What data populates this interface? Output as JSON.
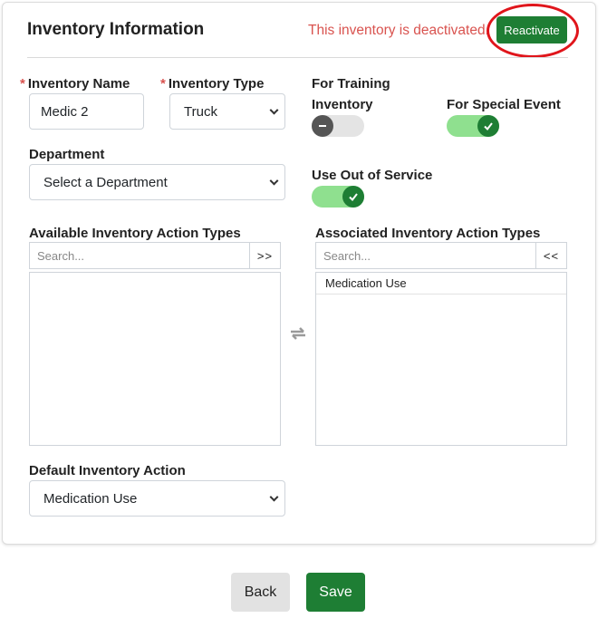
{
  "header": {
    "title": "Inventory Information",
    "status_message": "This inventory is deactivated.",
    "reactivate_label": "Reactivate"
  },
  "fields": {
    "required_mark": "*",
    "inventory_name": {
      "label": "Inventory Name",
      "value": "Medic 2"
    },
    "inventory_type": {
      "label": "Inventory Type",
      "value": "Truck"
    },
    "department": {
      "label": "Department",
      "value": "Select a Department"
    },
    "default_action": {
      "label": "Default Inventory Action",
      "value": "Medication Use"
    }
  },
  "toggles": {
    "training": {
      "label_line1": "For Training",
      "label_line2": "Inventory",
      "state": "off"
    },
    "special_event": {
      "label": "For Special Event",
      "state": "on"
    },
    "out_of_service": {
      "label": "Use Out of Service",
      "state": "on"
    }
  },
  "available": {
    "label": "Available Inventory Action Types",
    "search_placeholder": "Search...",
    "move_label": ">>",
    "items": []
  },
  "associated": {
    "label": "Associated Inventory Action Types",
    "search_placeholder": "Search...",
    "move_label": "<<",
    "items": [
      "Medication Use"
    ]
  },
  "footer": {
    "back_label": "Back",
    "save_label": "Save"
  },
  "colors": {
    "accent_green": "#1e7e34",
    "toggle_on": "#8fe08f",
    "warning_red": "#d9534f",
    "highlight_ellipse": "#e0151b"
  },
  "icons": {
    "swap": "swap-arrows-icon",
    "check": "check-icon",
    "minus": "minus-icon",
    "chevron": "chevron-down-icon"
  }
}
